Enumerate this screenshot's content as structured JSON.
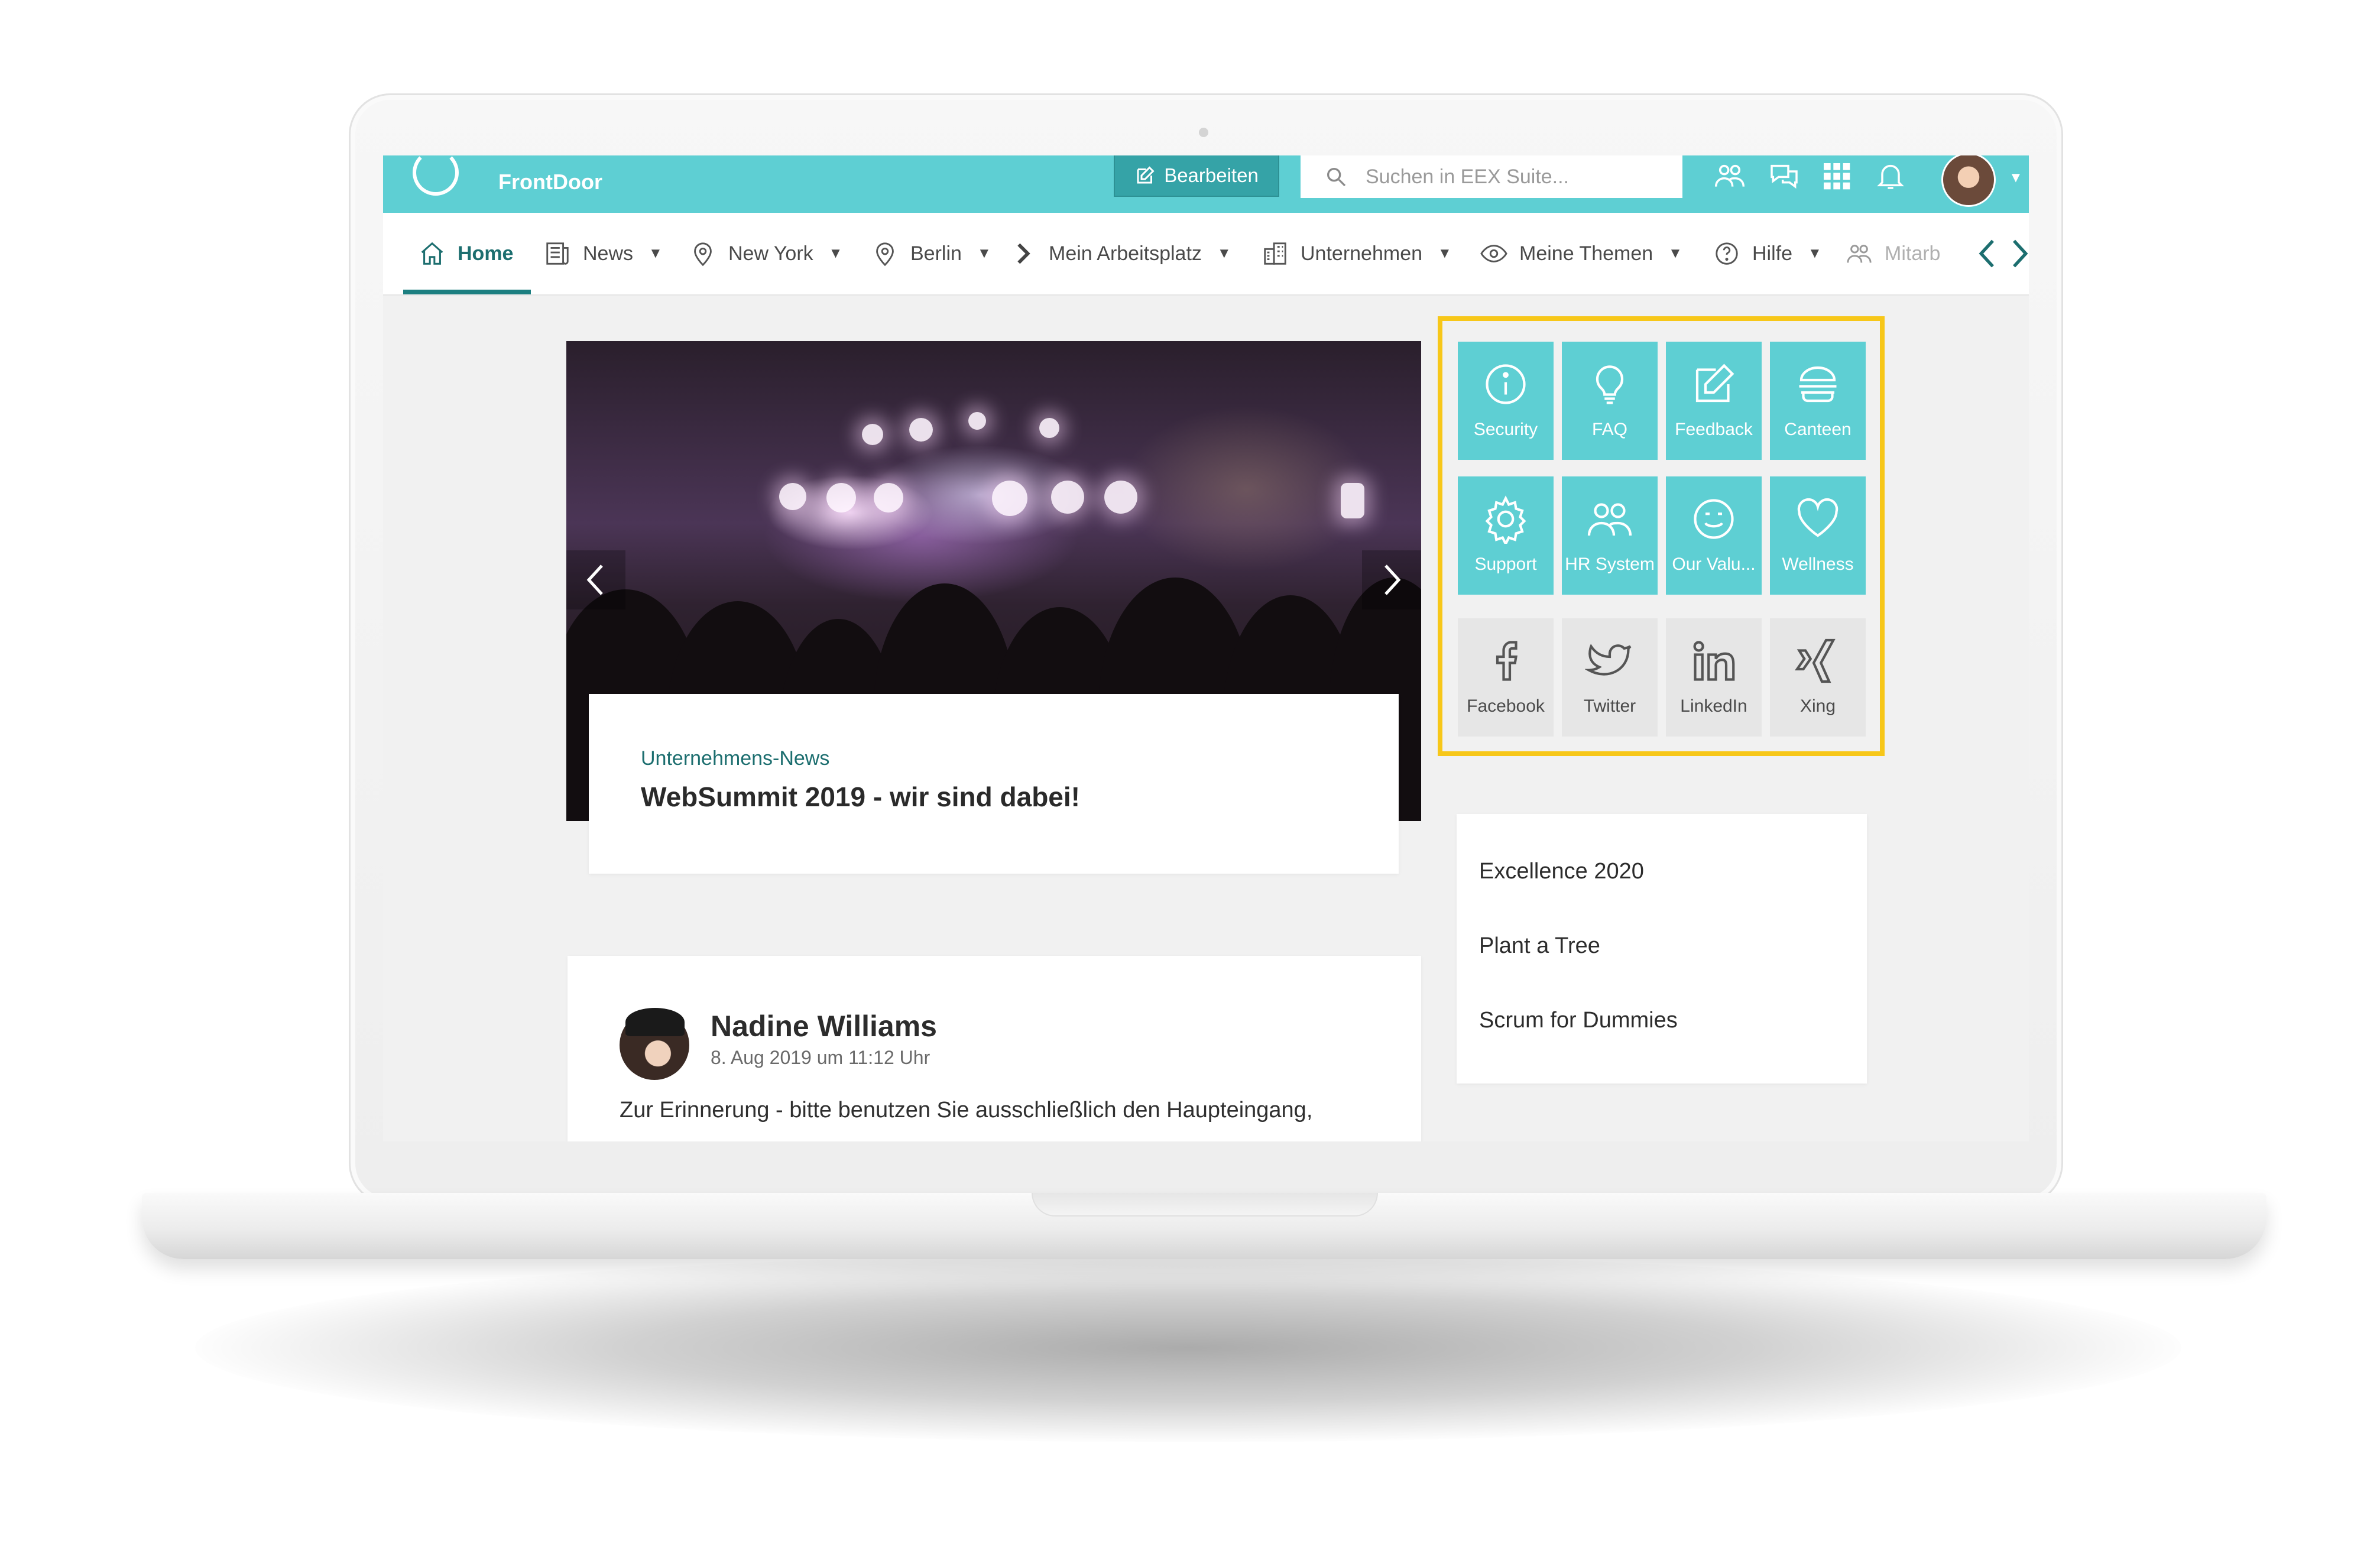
{
  "app": {
    "name": "FrontDoor",
    "edit_label": "Bearbeiten",
    "search_placeholder": "Suchen in EEX Suite...",
    "colors": {
      "accent": "#5ecfd3",
      "accent_dark": "#1c6e6f",
      "highlight": "#f7c719"
    }
  },
  "topbar_icons": [
    "people-icon",
    "chat-icon",
    "apps-grid-icon",
    "bell-icon"
  ],
  "nav": {
    "items": [
      {
        "label": "Home",
        "icon": "home-icon",
        "active": true
      },
      {
        "label": "News",
        "icon": "newspaper-icon"
      },
      {
        "label": "New York",
        "icon": "location-pin-icon"
      },
      {
        "label": "Berlin",
        "icon": "location-pin-icon"
      },
      {
        "label": "Mein Arbeitsplatz",
        "icon": "chevron-right-icon"
      },
      {
        "label": "Unternehmen",
        "icon": "building-icon"
      },
      {
        "label": "Meine Themen",
        "icon": "eye-icon"
      },
      {
        "label": "Hilfe",
        "icon": "help-circle-icon"
      },
      {
        "label": "Mitarb",
        "icon": "people-icon"
      }
    ]
  },
  "hero": {
    "category": "Unternehmens-News",
    "headline": "WebSummit 2019 - wir sind dabei!"
  },
  "quick_links": [
    {
      "label": "Security",
      "icon": "info-icon"
    },
    {
      "label": "FAQ",
      "icon": "lightbulb-icon"
    },
    {
      "label": "Feedback",
      "icon": "edit-icon"
    },
    {
      "label": "Canteen",
      "icon": "burger-icon"
    },
    {
      "label": "Support",
      "icon": "gear-icon"
    },
    {
      "label": "HR System",
      "icon": "people-icon"
    },
    {
      "label": "Our Valu...",
      "icon": "smile-icon"
    },
    {
      "label": "Wellness",
      "icon": "heart-icon"
    },
    {
      "label": "Facebook",
      "icon": "facebook-icon"
    },
    {
      "label": "Twitter",
      "icon": "twitter-icon"
    },
    {
      "label": "LinkedIn",
      "icon": "linkedin-icon"
    },
    {
      "label": "Xing",
      "icon": "xing-icon"
    }
  ],
  "topics": [
    "Excellence 2020",
    "Plant a Tree",
    "Scrum for Dummies"
  ],
  "post": {
    "author": "Nadine Williams",
    "date": "8. Aug 2019 um 11:12 Uhr",
    "text": "Zur Erinnerung - bitte benutzen Sie ausschließlich den Haupteingang,"
  }
}
